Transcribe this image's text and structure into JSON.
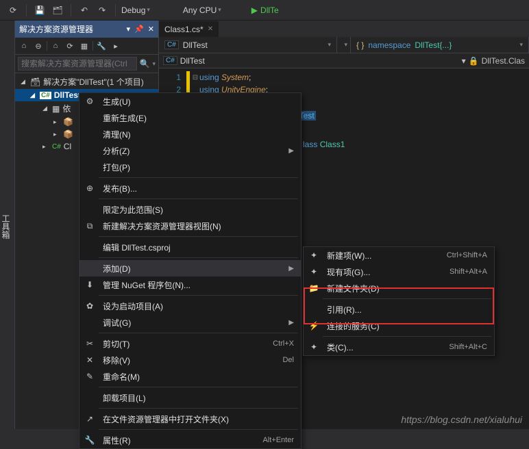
{
  "toolbar": {
    "config": "Debug",
    "platform": "Any CPU",
    "start": "DllTe"
  },
  "sidebar": {
    "title": "解决方案资源管理器",
    "search_placeholder": "搜索解决方案资源管理器(Ctrl",
    "solution": "解决方案\"DllTest\"(1 个项目)",
    "project": "DllTest",
    "deps": "依",
    "class_item": "Cl"
  },
  "editor": {
    "tab": "Class1.cs*",
    "nav_project": "DllTest",
    "nav_ns_prefix": "namespace",
    "nav_ns": "DllTest{...}",
    "breadcrumb": "DllTest",
    "bc_right": "DllTest.Clas",
    "code": {
      "l1_using": "using",
      "l1_ns": "System",
      "l2_using": "using",
      "l2_ns": "UnityEngine",
      "ns_title": "lTest",
      "class_kw": "lass",
      "class_name": "Class1"
    }
  },
  "context_menu": {
    "items": [
      {
        "icon": "⚙",
        "label": "生成(U)",
        "shortcut": "",
        "sep": false
      },
      {
        "icon": "",
        "label": "重新生成(E)",
        "shortcut": "",
        "sep": false
      },
      {
        "icon": "",
        "label": "清理(N)",
        "shortcut": "",
        "sep": false
      },
      {
        "icon": "",
        "label": "分析(Z)",
        "shortcut": "",
        "arrow": true,
        "sep": false
      },
      {
        "icon": "",
        "label": "打包(P)",
        "shortcut": "",
        "sep": true
      },
      {
        "icon": "⊕",
        "label": "发布(B)...",
        "shortcut": "",
        "sep": true
      },
      {
        "icon": "",
        "label": "限定为此范围(S)",
        "shortcut": "",
        "sep": false
      },
      {
        "icon": "⧉",
        "label": "新建解决方案资源管理器视图(N)",
        "shortcut": "",
        "sep": true
      },
      {
        "icon": "",
        "label": "编辑 DllTest.csproj",
        "shortcut": "",
        "sep": true
      },
      {
        "icon": "",
        "label": "添加(D)",
        "shortcut": "",
        "arrow": true,
        "highlight": true,
        "sep": false
      },
      {
        "icon": "⬇",
        "label": "管理 NuGet 程序包(N)...",
        "shortcut": "",
        "sep": true
      },
      {
        "icon": "✿",
        "label": "设为启动项目(A)",
        "shortcut": "",
        "sep": false
      },
      {
        "icon": "",
        "label": "调试(G)",
        "shortcut": "",
        "arrow": true,
        "sep": true
      },
      {
        "icon": "✂",
        "label": "剪切(T)",
        "shortcut": "Ctrl+X",
        "sep": false
      },
      {
        "icon": "✕",
        "label": "移除(V)",
        "shortcut": "Del",
        "sep": false
      },
      {
        "icon": "✎",
        "label": "重命名(M)",
        "shortcut": "",
        "sep": true
      },
      {
        "icon": "",
        "label": "卸载项目(L)",
        "shortcut": "",
        "sep": true
      },
      {
        "icon": "↗",
        "label": "在文件资源管理器中打开文件夹(X)",
        "shortcut": "",
        "sep": true
      },
      {
        "icon": "🔧",
        "label": "属性(R)",
        "shortcut": "Alt+Enter",
        "sep": false
      }
    ]
  },
  "sub_menu": {
    "items": [
      {
        "icon": "✦",
        "label": "新建项(W)...",
        "shortcut": "Ctrl+Shift+A",
        "sep": false
      },
      {
        "icon": "✦",
        "label": "现有项(G)...",
        "shortcut": "Shift+Alt+A",
        "sep": false
      },
      {
        "icon": "📁",
        "label": "新建文件夹(D)",
        "shortcut": "",
        "sep": true
      },
      {
        "icon": "",
        "label": "引用(R)...",
        "shortcut": "",
        "sep": false
      },
      {
        "icon": "⚡",
        "label": "连接的服务(C)",
        "shortcut": "",
        "sep": true
      },
      {
        "icon": "✦",
        "label": "类(C)...",
        "shortcut": "Shift+Alt+C",
        "sep": false
      }
    ]
  },
  "watermark": "https://blog.csdn.net/xialuhui"
}
